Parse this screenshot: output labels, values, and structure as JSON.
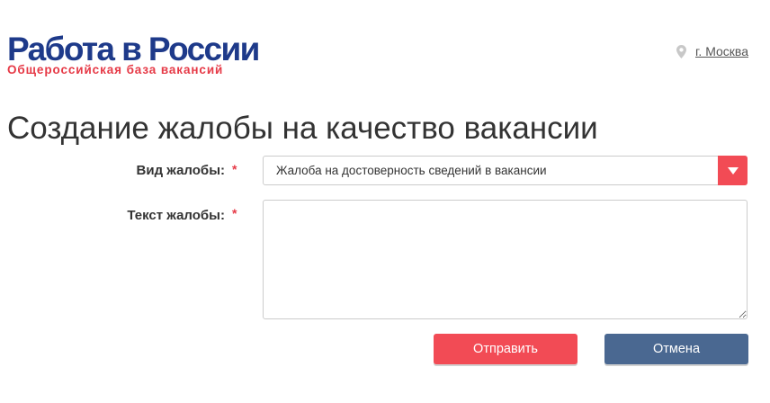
{
  "header": {
    "logo_title": "Работа в России",
    "logo_subtitle": "Общероссийская база вакансий",
    "city_icon": "map-pin-icon",
    "city": "г. Москва"
  },
  "page": {
    "title": "Создание жалобы на качество вакансии"
  },
  "form": {
    "type_label": "Вид жалобы:",
    "type_value": "Жалоба на достоверность сведений в вакансии",
    "type_icon": "chevron-down-icon",
    "text_label": "Текст жалобы:",
    "text_value": "",
    "required_mark": "*",
    "submit_label": "Отправить",
    "cancel_label": "Отмена"
  },
  "colors": {
    "brand_blue": "#1e3a8a",
    "brand_red": "#e63946",
    "submit_bg": "#f24b55",
    "cancel_bg": "#4a6891"
  }
}
